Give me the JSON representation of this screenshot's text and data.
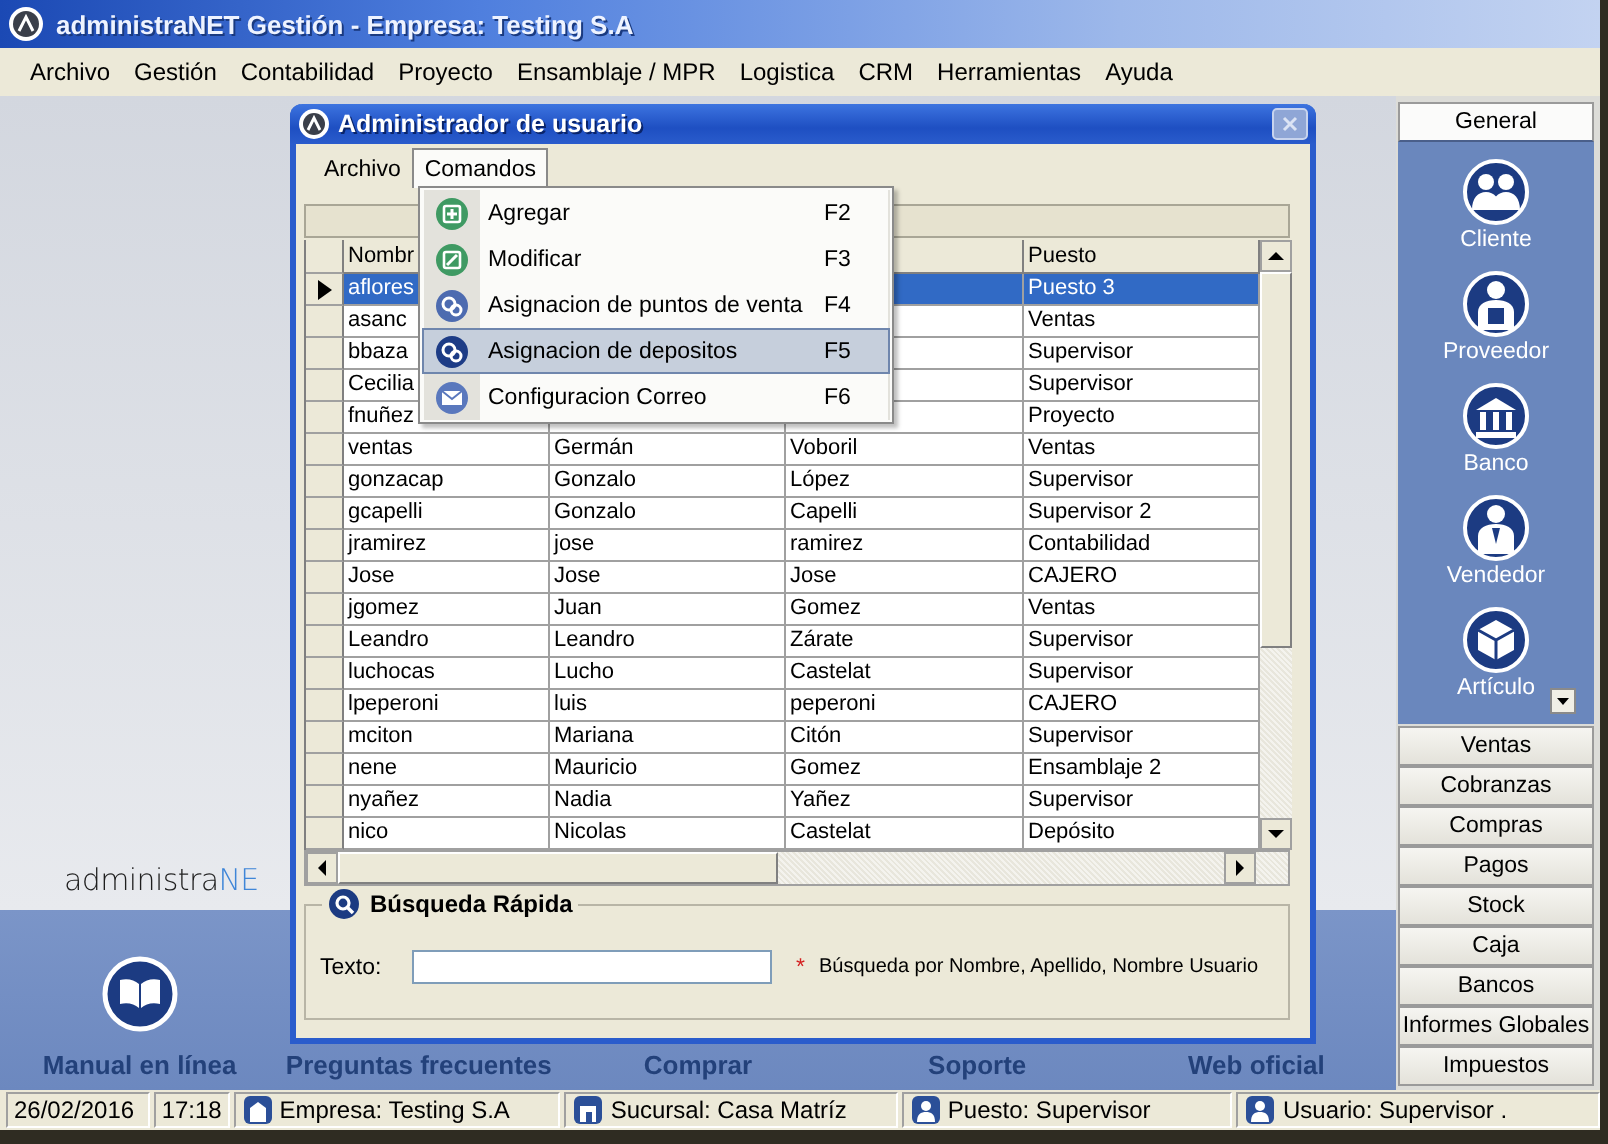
{
  "window": {
    "title": "administraNET Gestión - Empresa: Testing S.A"
  },
  "menu_bar": [
    "Archivo",
    "Gestión",
    "Contabilidad",
    "Proyecto",
    "Ensamblaje / MPR",
    "Logistica",
    "CRM",
    "Herramientas",
    "Ayuda"
  ],
  "background": {
    "logo": {
      "text": "administra",
      "accent": "NE"
    },
    "links": [
      "Manual en línea",
      "Preguntas frecuentes",
      "Comprar",
      "Soporte",
      "Web oficial"
    ]
  },
  "dialog": {
    "title": "Administrador de usuario",
    "menu": [
      {
        "label": "Archivo",
        "selected": false
      },
      {
        "label": "Comandos",
        "selected": true
      }
    ],
    "commands": [
      {
        "label": "Agregar",
        "shortcut": "F2",
        "selected": false
      },
      {
        "label": "Modificar",
        "shortcut": "F3",
        "selected": false
      },
      {
        "label": "Asignacion de puntos de venta",
        "shortcut": "F4",
        "selected": false
      },
      {
        "label": "Asignacion de depositos",
        "shortcut": "F5",
        "selected": true
      },
      {
        "label": "Configuracion Correo",
        "shortcut": "F6",
        "selected": false
      }
    ],
    "table": {
      "columns": [
        "Nombr",
        null,
        null,
        "Puesto"
      ],
      "rows": [
        {
          "cells": [
            "aflores",
            null,
            null,
            "Puesto 3"
          ],
          "selected": true
        },
        {
          "cells": [
            "asanc",
            null,
            null,
            "Ventas"
          ],
          "selected": false
        },
        {
          "cells": [
            "bbaza",
            null,
            null,
            "Supervisor"
          ],
          "selected": false
        },
        {
          "cells": [
            "Cecilia",
            null,
            null,
            "Supervisor"
          ],
          "selected": false
        },
        {
          "cells": [
            "fnuñez",
            null,
            null,
            "Proyecto"
          ],
          "selected": false
        },
        {
          "cells": [
            "ventas",
            "Germán",
            "Voboril",
            "Ventas"
          ],
          "selected": false
        },
        {
          "cells": [
            "gonzacap",
            "Gonzalo",
            "López",
            "Supervisor"
          ],
          "selected": false
        },
        {
          "cells": [
            "gcapelli",
            "Gonzalo",
            "Capelli",
            "Supervisor 2"
          ],
          "selected": false
        },
        {
          "cells": [
            "jramirez",
            "jose",
            "ramirez",
            "Contabilidad"
          ],
          "selected": false
        },
        {
          "cells": [
            "Jose",
            "Jose",
            "Jose",
            "CAJERO"
          ],
          "selected": false
        },
        {
          "cells": [
            "jgomez",
            "Juan",
            "Gomez",
            "Ventas"
          ],
          "selected": false
        },
        {
          "cells": [
            "Leandro",
            "Leandro",
            "Zárate",
            "Supervisor"
          ],
          "selected": false
        },
        {
          "cells": [
            "luchocas",
            "Lucho",
            "Castelat",
            "Supervisor"
          ],
          "selected": false
        },
        {
          "cells": [
            "lpeperoni",
            "luis",
            "peperoni",
            "CAJERO"
          ],
          "selected": false
        },
        {
          "cells": [
            "mciton",
            "Mariana",
            "Citón",
            "Supervisor"
          ],
          "selected": false
        },
        {
          "cells": [
            "nene",
            "Mauricio",
            "Gomez",
            "Ensamblaje 2"
          ],
          "selected": false
        },
        {
          "cells": [
            "nyañez",
            "Nadia",
            "Yañez",
            "Supervisor"
          ],
          "selected": false
        },
        {
          "cells": [
            "nico",
            "Nicolas",
            "Castelat",
            "Depósito"
          ],
          "selected": false
        }
      ]
    },
    "search": {
      "title": "Búsqueda Rápida",
      "label": "Texto:",
      "required_mark": "*",
      "hint": "Búsqueda por Nombre, Apellido, Nombre Usuario"
    }
  },
  "side_panel": {
    "groups": [
      {
        "label": "General",
        "expanded": true,
        "items": [
          "Cliente",
          "Proveedor",
          "Banco",
          "Vendedor",
          "Artículo"
        ]
      },
      {
        "label": "Ventas",
        "expanded": false
      },
      {
        "label": "Cobranzas",
        "expanded": false
      },
      {
        "label": "Compras",
        "expanded": false
      },
      {
        "label": "Pagos",
        "expanded": false
      },
      {
        "label": "Stock",
        "expanded": false
      },
      {
        "label": "Caja",
        "expanded": false
      },
      {
        "label": "Bancos",
        "expanded": false
      },
      {
        "label": "Informes Globales",
        "expanded": false
      },
      {
        "label": "Impuestos",
        "expanded": false
      }
    ]
  },
  "status_bar": [
    "26/02/2016",
    "17:18",
    "Empresa: Testing S.A",
    "Sucursal: Casa Matríz",
    "Puesto: Supervisor",
    "Usuario: Supervisor ."
  ]
}
